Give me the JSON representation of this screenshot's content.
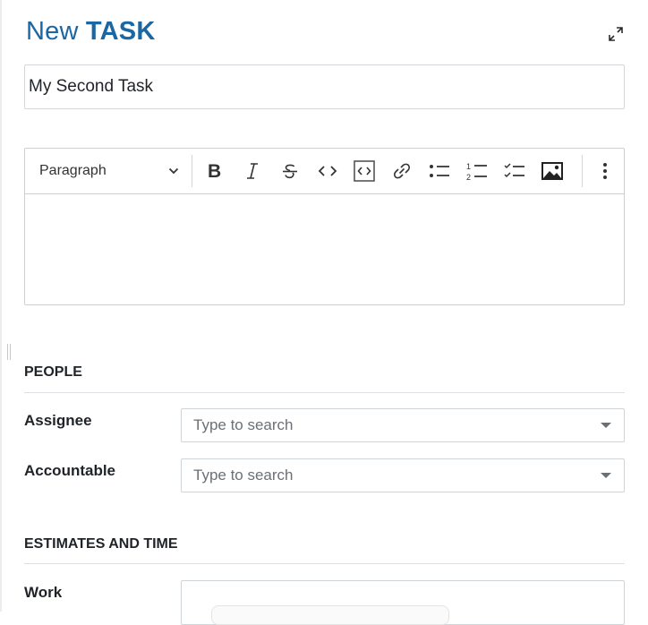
{
  "header": {
    "title_prefix": "New",
    "title_type": "TASK",
    "expand_icon": "expand-arrows-icon"
  },
  "subject": {
    "value": "My Second Task"
  },
  "editor": {
    "heading_select": "Paragraph",
    "toolbar": [
      {
        "name": "bold",
        "icon": "bold-icon"
      },
      {
        "name": "italic",
        "icon": "italic-icon"
      },
      {
        "name": "strikethrough",
        "icon": "strikethrough-icon"
      },
      {
        "name": "code",
        "icon": "code-icon"
      },
      {
        "name": "code-block",
        "icon": "code-block-icon"
      },
      {
        "name": "link",
        "icon": "link-icon"
      },
      {
        "name": "bulleted-list",
        "icon": "bulleted-list-icon"
      },
      {
        "name": "numbered-list",
        "icon": "numbered-list-icon"
      },
      {
        "name": "todo-list",
        "icon": "todo-list-icon"
      },
      {
        "name": "image",
        "icon": "image-icon"
      },
      {
        "name": "more",
        "icon": "more-vertical-icon"
      }
    ],
    "content": ""
  },
  "sections": {
    "people": {
      "title": "PEOPLE",
      "fields": [
        {
          "label": "Assignee",
          "placeholder": "Type to search"
        },
        {
          "label": "Accountable",
          "placeholder": "Type to search"
        }
      ]
    },
    "estimates": {
      "title": "ESTIMATES AND TIME",
      "fields": [
        {
          "label": "Work",
          "value": ""
        }
      ]
    }
  }
}
